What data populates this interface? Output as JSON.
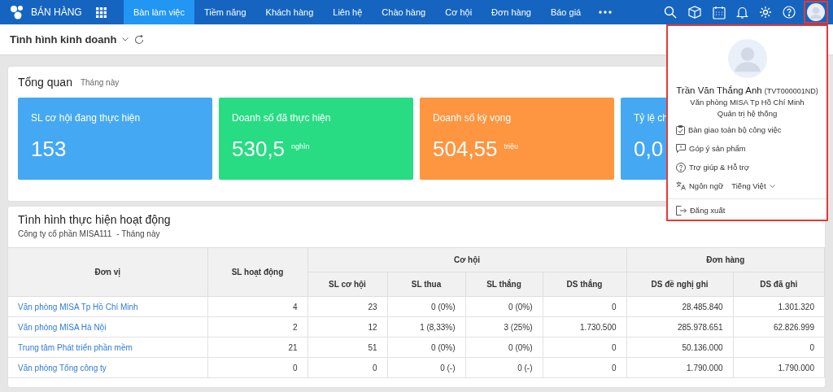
{
  "app": {
    "title": "BÁN HÀNG"
  },
  "nav_tabs": [
    {
      "label": "Bàn làm việc",
      "selected": true
    },
    {
      "label": "Tiềm năng",
      "selected": false
    },
    {
      "label": "Khách hàng",
      "selected": false
    },
    {
      "label": "Liên hệ",
      "selected": false
    },
    {
      "label": "Chào hàng",
      "selected": false
    },
    {
      "label": "Cơ hội",
      "selected": false
    },
    {
      "label": "Đơn hàng",
      "selected": false
    },
    {
      "label": "Báo giá",
      "selected": false
    }
  ],
  "page_header": {
    "title": "Tình hình kinh doanh"
  },
  "overview": {
    "title": "Tổng quan",
    "period": "Tháng này",
    "cards": [
      {
        "title": "SL cơ hội đang thực hiện",
        "value": "153",
        "color": "#45a8f2"
      },
      {
        "title": "Doanh số đã thực hiện",
        "value": "530,5",
        "unit": "nghìn",
        "color": "#27dc82"
      },
      {
        "title": "Doanh số kỳ vọng",
        "value": "504,55",
        "unit": "triệu",
        "color": "#fd9541"
      },
      {
        "title": "Tỷ lệ ch",
        "value": "0,0",
        "color": "#45a8f2"
      }
    ]
  },
  "activity": {
    "title": "Tình hình thực hiện hoạt động",
    "company": "Công ty cổ phần MISA111",
    "period": "- Tháng này",
    "header": [
      {
        "label": "Đơn vị"
      },
      {
        "label": "SL hoạt động"
      },
      {
        "label": "Cơ hội",
        "children": [
          {
            "label": "SL cơ hội"
          },
          {
            "label": "SL thua"
          },
          {
            "label": "SL thắng"
          },
          {
            "label": "DS thắng"
          }
        ]
      },
      {
        "label": "Đơn hàng",
        "children": [
          {
            "label": "DS đề nghị ghi"
          },
          {
            "label": "DS đã ghi"
          }
        ]
      }
    ],
    "rows": [
      {
        "unit": "Văn phòng MISA Tp Hồ Chí Minh",
        "values": [
          "4",
          "23",
          "0 (0%)",
          "0 (0%)",
          "0",
          "28.485.840",
          "1.301.320"
        ]
      },
      {
        "unit": "Văn phòng MISA Hà Nội",
        "values": [
          "2",
          "12",
          "1 (8,33%)",
          "3 (25%)",
          "1.730.500",
          "285.978.651",
          "62.826.999"
        ]
      },
      {
        "unit": "Trung tâm Phát triển phần mềm",
        "values": [
          "21",
          "51",
          "0 (0%)",
          "0 (0%)",
          "0",
          "50.136.000",
          "0"
        ]
      },
      {
        "unit": "Văn phòng Tổng công ty",
        "values": [
          "0",
          "0",
          "0 (-)",
          "0 (-)",
          "0",
          "1.790.000",
          "1.790.000"
        ]
      }
    ]
  },
  "user_menu": {
    "name": "Trần Văn Thắng Anh",
    "code": "(TVT000001ND)",
    "office": "Văn phòng MISA Tp Hồ Chí Minh",
    "role": "Quản trị hệ thống",
    "items": [
      {
        "kind": "handover",
        "label": "Bàn giao toàn bộ công việc"
      },
      {
        "kind": "feedback",
        "label": "Góp ý sản phẩm"
      },
      {
        "kind": "help",
        "label": "Trợ giúp & Hỗ trợ"
      },
      {
        "kind": "language",
        "label": "Ngôn ngữ",
        "value": "Tiếng Việt"
      },
      {
        "kind": "logout",
        "label": "Đăng xuất"
      }
    ]
  }
}
